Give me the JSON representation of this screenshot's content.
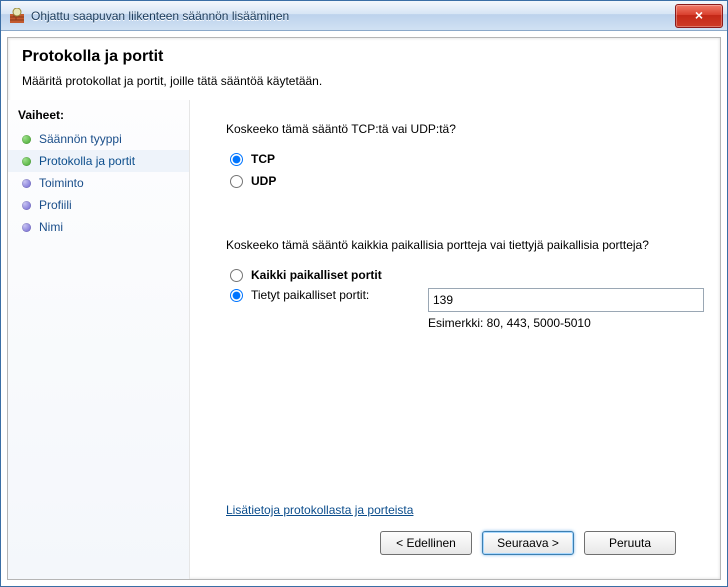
{
  "window": {
    "title": "Ohjattu saapuvan liikenteen säännön lisääminen"
  },
  "header": {
    "title": "Protokolla ja portit",
    "subtitle": "Määritä protokollat ja portit, joille tätä sääntöä käytetään."
  },
  "sidebar": {
    "heading": "Vaiheet:",
    "steps": [
      {
        "label": "Säännön tyyppi",
        "state": "past"
      },
      {
        "label": "Protokolla ja portit",
        "state": "current"
      },
      {
        "label": "Toiminto",
        "state": "future"
      },
      {
        "label": "Profiili",
        "state": "future"
      },
      {
        "label": "Nimi",
        "state": "future"
      }
    ]
  },
  "main": {
    "question1": "Koskeeko tämä sääntö TCP:tä vai UDP:tä?",
    "protocol": {
      "tcp_label": "TCP",
      "udp_label": "UDP",
      "selected": "tcp"
    },
    "question2": "Koskeeko tämä sääntö kaikkia paikallisia portteja vai tiettyjä paikallisia portteja?",
    "ports": {
      "all_label": "Kaikki paikalliset portit",
      "specific_label": "Tietyt paikalliset portit:",
      "selected": "specific",
      "value": "139",
      "example": "Esimerkki: 80, 443, 5000-5010"
    },
    "link": "Lisätietoja protokollasta ja porteista"
  },
  "buttons": {
    "back": "< Edellinen",
    "next": "Seuraava >",
    "cancel": "Peruuta"
  }
}
